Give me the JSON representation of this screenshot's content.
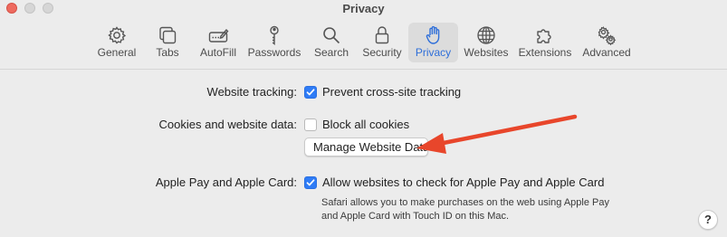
{
  "window": {
    "title": "Privacy"
  },
  "toolbar": {
    "tabs": [
      {
        "label": "General",
        "icon": "gear-icon"
      },
      {
        "label": "Tabs",
        "icon": "tabs-icon"
      },
      {
        "label": "AutoFill",
        "icon": "autofill-icon"
      },
      {
        "label": "Passwords",
        "icon": "key-icon"
      },
      {
        "label": "Search",
        "icon": "search-icon"
      },
      {
        "label": "Security",
        "icon": "lock-icon"
      },
      {
        "label": "Privacy",
        "icon": "hand-icon",
        "active": true
      },
      {
        "label": "Websites",
        "icon": "globe-icon"
      },
      {
        "label": "Extensions",
        "icon": "puzzle-icon"
      },
      {
        "label": "Advanced",
        "icon": "gears-icon"
      }
    ]
  },
  "settings": {
    "tracking": {
      "label": "Website tracking:",
      "option": "Prevent cross-site tracking",
      "checked": true
    },
    "cookies": {
      "label": "Cookies and website data:",
      "option": "Block all cookies",
      "checked": false,
      "button": "Manage Website Data..."
    },
    "applepay": {
      "label": "Apple Pay and Apple Card:",
      "option": "Allow websites to check for Apple Pay and Apple Card",
      "checked": true,
      "note_line1": "Safari allows you to make purchases on the web using Apple Pay",
      "note_line2": "and Apple Card with Touch ID on this Mac."
    }
  },
  "help": {
    "label": "?"
  },
  "colors": {
    "accent": "#2f7cf6",
    "annotation_arrow": "#e8462b",
    "active_tab_text": "#2f6fd9"
  }
}
